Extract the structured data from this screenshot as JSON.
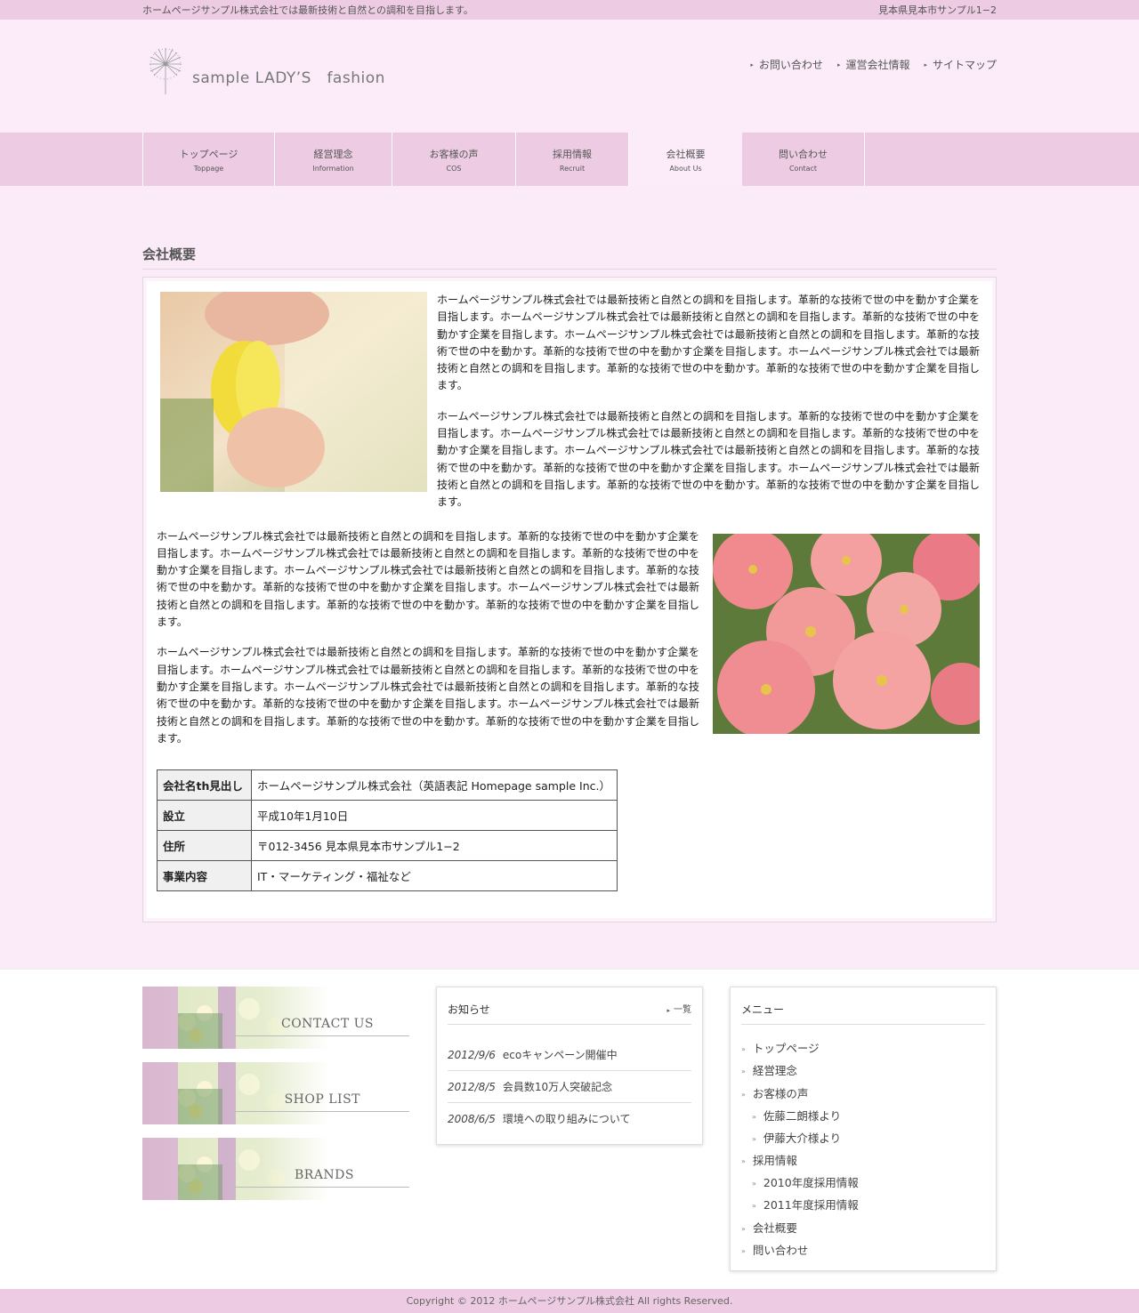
{
  "topbar": {
    "tagline": "ホームページサンプル株式会社では最新技術と自然との調和を目指します。",
    "address": "見本県見本市サンプル1−2"
  },
  "header": {
    "logo_text": "sample LADY’S　fashion",
    "links": [
      "お問い合わせ",
      "運営会社情報",
      "サイトマップ"
    ]
  },
  "nav": [
    {
      "jp": "トップページ",
      "en": "Toppage"
    },
    {
      "jp": "経営理念",
      "en": "Information"
    },
    {
      "jp": "お客様の声",
      "en": "COS"
    },
    {
      "jp": "採用情報",
      "en": "Recruit"
    },
    {
      "jp": "会社概要",
      "en": "About Us"
    },
    {
      "jp": "問い合わせ",
      "en": "Contact"
    }
  ],
  "page_title": "会社概要",
  "paragraph": "ホームページサンプル株式会社では最新技術と自然との調和を目指します。革新的な技術で世の中を動かす企業を目指します。ホームページサンプル株式会社では最新技術と自然との調和を目指します。革新的な技術で世の中を動かす企業を目指します。ホームページサンプル株式会社では最新技術と自然との調和を目指します。革新的な技術で世の中を動かす。革新的な技術で世の中を動かす企業を目指します。ホームページサンプル株式会社では最新技術と自然との調和を目指します。革新的な技術で世の中を動かす。革新的な技術で世の中を動かす企業を目指します。",
  "company_table": [
    {
      "label": "会社名th見出し",
      "value": "ホームページサンプル株式会社（英語表記 Homepage sample Inc.）"
    },
    {
      "label": "設立",
      "value": "平成10年1月10日"
    },
    {
      "label": "住所",
      "value": "〒012-3456 見本県見本市サンプル1−2"
    },
    {
      "label": "事業内容",
      "value": "IT・マーケティング・福祉など"
    }
  ],
  "banners": [
    "CONTACT US",
    "SHOP LIST",
    "BRANDS"
  ],
  "news": {
    "title": "お知らせ",
    "more": "一覧",
    "items": [
      {
        "date": "2012/9/6",
        "text": "ecoキャンペーン開催中"
      },
      {
        "date": "2012/8/5",
        "text": "会員数10万人突破記念"
      },
      {
        "date": "2008/6/5",
        "text": "環境への取り組みについて"
      }
    ]
  },
  "menu": {
    "title": "メニュー",
    "items": [
      {
        "label": "トップページ",
        "sub": false
      },
      {
        "label": "経営理念",
        "sub": false
      },
      {
        "label": "お客様の声",
        "sub": false
      },
      {
        "label": "佐藤二朗様より",
        "sub": true
      },
      {
        "label": "伊藤大介様より",
        "sub": true
      },
      {
        "label": "採用情報",
        "sub": false
      },
      {
        "label": "2010年度採用情報",
        "sub": true
      },
      {
        "label": "2011年度採用情報",
        "sub": true
      },
      {
        "label": "会社概要",
        "sub": false
      },
      {
        "label": "問い合わせ",
        "sub": false
      }
    ]
  },
  "copyright": "Copyright © 2012 ホームページサンプル株式会社 All rights Reserved.",
  "colors": {
    "pink_bar": "#eccbe3",
    "page_bg": "#fbeaf8"
  }
}
